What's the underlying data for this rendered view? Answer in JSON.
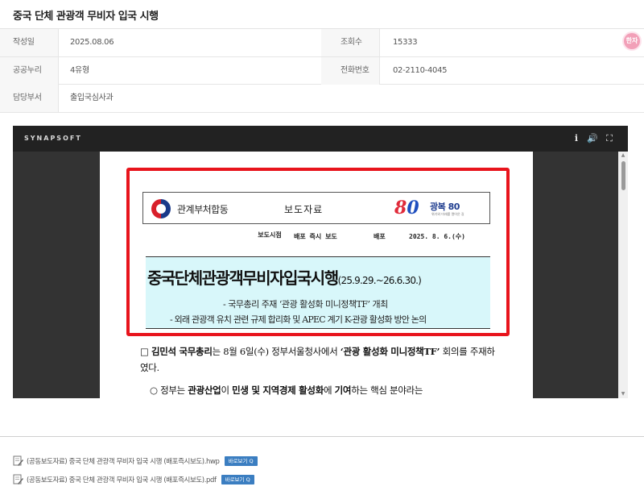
{
  "title": "중국 단체 관광객 무비자 입국 시행",
  "info": {
    "created_label": "작성일",
    "created_value": "2025.08.06",
    "views_label": "조회수",
    "views_value": "15333",
    "license_label": "공공누리",
    "license_value": "4유형",
    "phone_label": "전화번호",
    "phone_value": "02-2110-4045",
    "dept_label": "담당부서",
    "dept_value": "출입국심사과"
  },
  "float_button": "한자",
  "viewer": {
    "brand": "SYNAPSOFT",
    "info_icon": "i",
    "volume_icon": "🔊",
    "fullscreen_icon": "⛶"
  },
  "document": {
    "org": "관계부처합동",
    "press": "보도자료",
    "logo80": "8",
    "logo80_b": "0",
    "gwang": "광복 80",
    "gwang_sub": "위기와 미래를 열어온 길",
    "release_label": "보도시점",
    "release_value": "배포 즉시 보도",
    "distribution_label": "배포",
    "distribution_date": "2025. 8. 6.(수)",
    "headline": "중국단체관광객무비자입국시행",
    "headline_dates": "(25.9.29.~26.6.30.)",
    "sub1": "- 국무총리 주재 ‘관광 활성화 미니정책TF’ 개최",
    "sub2": "- 외래 관광객 유치 관련 규제 합리화 및 APEC 계기 K-관광 활성화 방안 논의",
    "p1_bullet": "□",
    "p1_a": "김민석 국무총리",
    "p1_b": "는 8월 6일(수) 정부서울청사에서 ",
    "p1_c": "‘관광 활성화 미니정책TF’",
    "p1_d": " 회의를 주재하였다.",
    "p2_bullet": "○",
    "p2_a": " 정부는 ",
    "p2_b": "관광산업",
    "p2_c": "이 ",
    "p2_d": "민생 및 지역경제 활성화",
    "p2_e": "에 ",
    "p2_f": "기여",
    "p2_g": "하는 핵심 분야라는"
  },
  "attachments": [
    {
      "name": "(공동보도자료) 중국 단체 관광객 무비자 입국 시행 (배포즉시보도).hwp",
      "button": "바로보기 Q"
    },
    {
      "name": "(공동보도자료) 중국 단체 관광객 무비자 입국 시행 (배포즉시보도).pdf",
      "button": "바로보기 Q"
    }
  ],
  "colors": {
    "accent": "#3b7ec1",
    "highlight_border": "#e8141c",
    "headline_bg": "#d8f7fa"
  }
}
